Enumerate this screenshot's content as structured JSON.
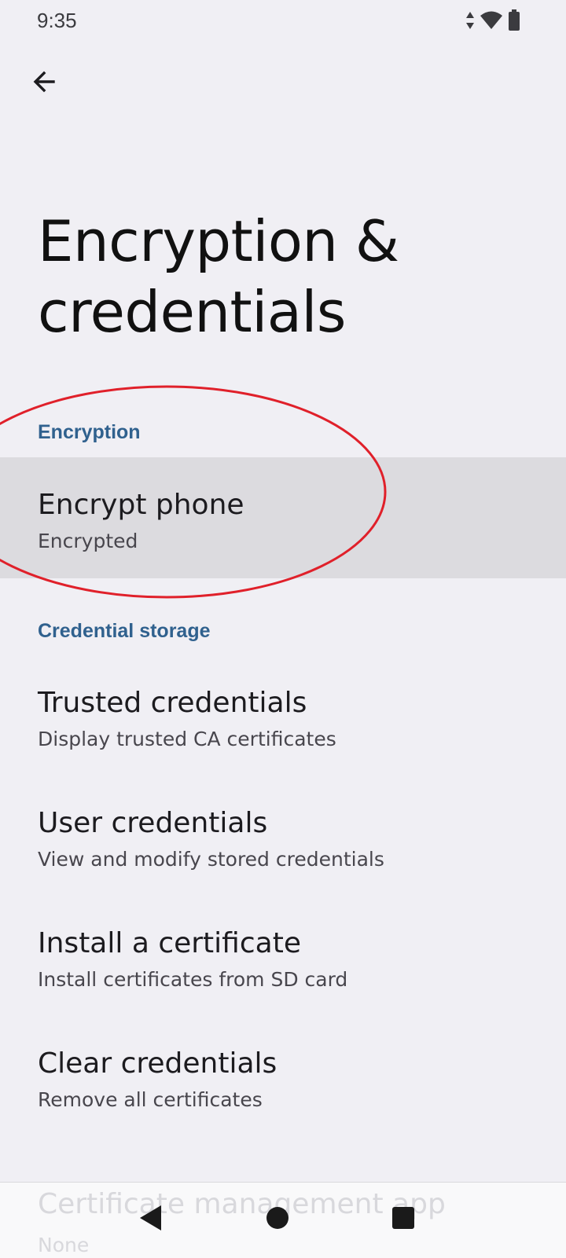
{
  "status_bar": {
    "time": "9:35",
    "icons": [
      "data-arrows-icon",
      "wifi-icon",
      "battery-icon"
    ]
  },
  "header": {
    "back_icon": "arrow-back-icon",
    "title": "Encryption & credentials"
  },
  "sections": [
    {
      "header": "Encryption",
      "items": [
        {
          "title": "Encrypt phone",
          "summary": "Encrypted"
        }
      ]
    },
    {
      "header": "Credential storage",
      "items": [
        {
          "title": "Trusted credentials",
          "summary": "Display trusted CA certificates"
        },
        {
          "title": "User credentials",
          "summary": "View and modify stored credentials"
        },
        {
          "title": "Install a certificate",
          "summary": "Install certificates from SD card"
        },
        {
          "title": "Clear credentials",
          "summary": "Remove all certificates"
        },
        {
          "title": "Certificate management app",
          "summary": "None"
        }
      ]
    }
  ],
  "navigation": {
    "back_icon": "nav-back-triangle-icon",
    "home_icon": "nav-home-circle-icon",
    "recents_icon": "nav-recents-square-icon"
  },
  "colors": {
    "background": "#f0eff4",
    "section_header": "#30618e",
    "highlight": "#dcdbdf",
    "annotation": "#e0202a"
  }
}
